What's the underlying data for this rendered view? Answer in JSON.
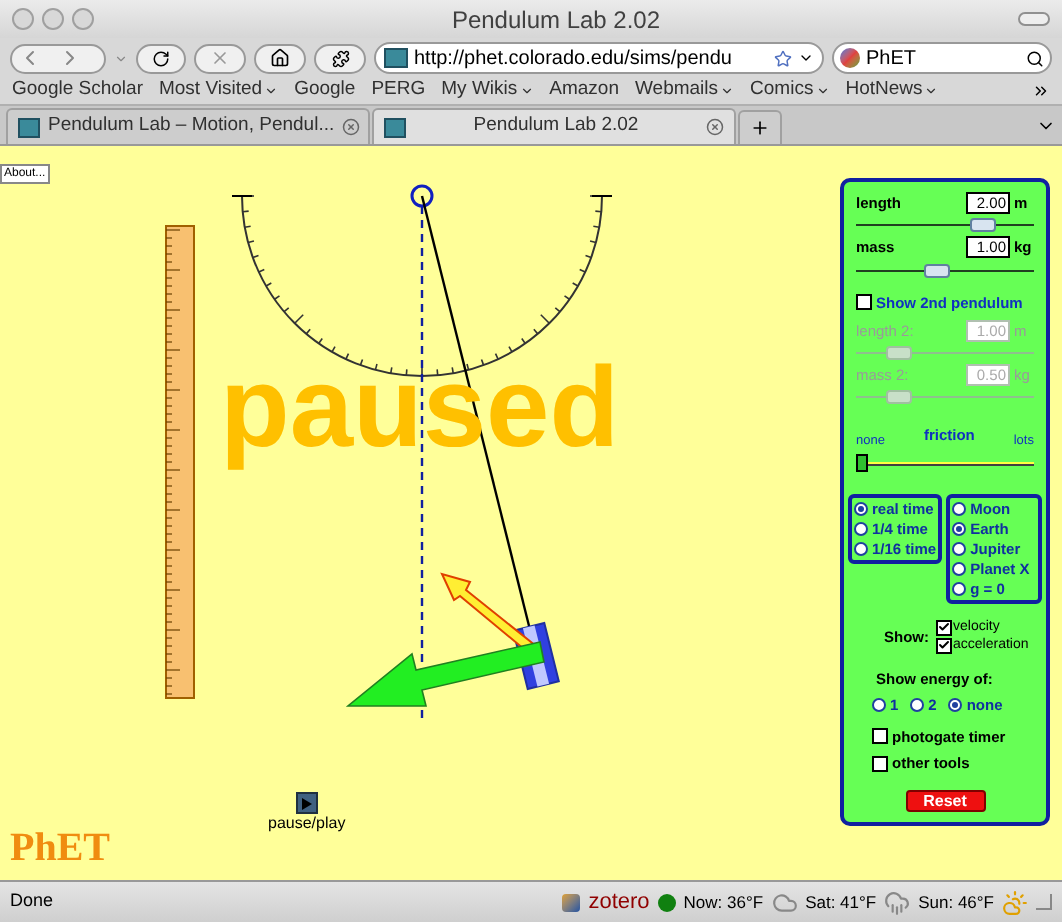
{
  "window": {
    "title": "Pendulum Lab 2.02"
  },
  "toolbar": {
    "url": "http://phet.colorado.edu/sims/pendu",
    "search": "PhET"
  },
  "bookmarks": [
    {
      "label": "Google Scholar",
      "menu": false
    },
    {
      "label": "Most Visited",
      "menu": true
    },
    {
      "label": "Google",
      "menu": false
    },
    {
      "label": "PERG",
      "menu": false
    },
    {
      "label": "My Wikis",
      "menu": true
    },
    {
      "label": "Amazon",
      "menu": false
    },
    {
      "label": "Webmails",
      "menu": true
    },
    {
      "label": "Comics",
      "menu": true
    },
    {
      "label": "HotNews",
      "menu": true
    }
  ],
  "tabs": [
    {
      "label": "Pendulum Lab – Motion, Pendul...",
      "selected": false
    },
    {
      "label": "Pendulum Lab 2.02",
      "selected": true
    }
  ],
  "sim": {
    "about_button": "About...",
    "overlay": "paused",
    "play_button": "pause/play",
    "logo": "PhET"
  },
  "controls": {
    "sliders": [
      {
        "label": "length",
        "value": "2.00",
        "unit": "m",
        "level": 0.75,
        "disabled": false
      },
      {
        "label": "mass",
        "value": "1.00",
        "unit": "kg",
        "level": 0.45,
        "disabled": false
      }
    ],
    "second_pendulum": {
      "label": "Show 2nd pendulum",
      "checked": false
    },
    "sliders_2": [
      {
        "label": "length 2:",
        "value": "1.00",
        "unit": "m",
        "level": 0.2,
        "disabled": true
      },
      {
        "label": "mass 2:",
        "value": "0.50",
        "unit": "kg",
        "level": 0.2,
        "disabled": true
      }
    ],
    "friction": {
      "label": "friction",
      "min_label": "none",
      "max_label": "lots",
      "level": 0.0
    },
    "time_options": [
      {
        "label": "real time",
        "selected": true
      },
      {
        "label": "1/4 time",
        "selected": false
      },
      {
        "label": "1/16 time",
        "selected": false
      }
    ],
    "gravity_options": [
      {
        "label": "Moon",
        "selected": false
      },
      {
        "label": "Earth",
        "selected": true
      },
      {
        "label": "Jupiter",
        "selected": false
      },
      {
        "label": "Planet X",
        "selected": false
      },
      {
        "label": "g = 0",
        "selected": false
      }
    ],
    "show_label": "Show:",
    "vectors": [
      {
        "label": "velocity",
        "checked": true
      },
      {
        "label": "acceleration",
        "checked": true
      }
    ],
    "energy_label": "Show energy of:",
    "energy_options": [
      {
        "label": "1",
        "selected": false
      },
      {
        "label": "2",
        "selected": false
      },
      {
        "label": "none",
        "selected": true
      }
    ],
    "tools": [
      {
        "label": "photogate timer",
        "checked": false
      },
      {
        "label": "other tools",
        "checked": false
      }
    ],
    "reset_button": "Reset"
  },
  "status_bar": {
    "text": "Done",
    "zotero": "zotero",
    "weather": [
      "Now: 36°F",
      "Sat: 41°F",
      "Sun: 46°F"
    ]
  }
}
